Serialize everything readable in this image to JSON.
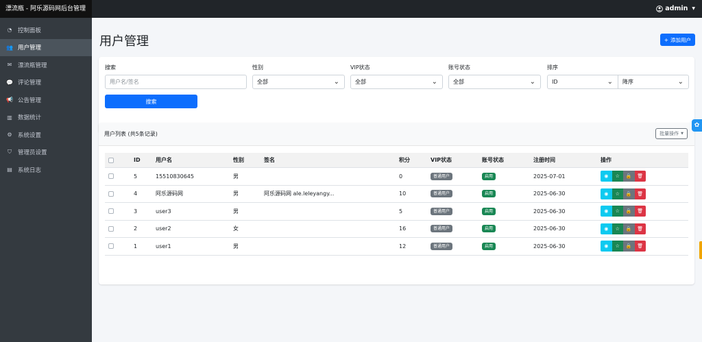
{
  "app": {
    "title": "漂流瓶 - 阿乐源码网后台管理",
    "user": "admin"
  },
  "sidebar": {
    "items": [
      {
        "label": "控制面板",
        "icon": "dashboard-icon",
        "glyph": "◔",
        "active": false
      },
      {
        "label": "用户管理",
        "icon": "users-icon",
        "glyph": "👥",
        "active": true
      },
      {
        "label": "漂流瓶管理",
        "icon": "envelope-icon",
        "glyph": "✉",
        "active": false
      },
      {
        "label": "评论管理",
        "icon": "comment-icon",
        "glyph": "💬",
        "active": false
      },
      {
        "label": "公告管理",
        "icon": "megaphone-icon",
        "glyph": "📢",
        "active": false
      },
      {
        "label": "数据统计",
        "icon": "bar-chart-icon",
        "glyph": "▥",
        "active": false
      },
      {
        "label": "系统设置",
        "icon": "gear-icon",
        "glyph": "⚙",
        "active": false
      },
      {
        "label": "管理员设置",
        "icon": "shield-icon",
        "glyph": "⛉",
        "active": false
      },
      {
        "label": "系统日志",
        "icon": "log-icon",
        "glyph": "▤",
        "active": false
      }
    ]
  },
  "page": {
    "title": "用户管理",
    "add_button": "添加用户"
  },
  "filters": {
    "search": {
      "label": "搜索",
      "placeholder": "用户名/签名"
    },
    "gender": {
      "label": "性别",
      "value": "全部"
    },
    "vip": {
      "label": "VIP状态",
      "value": "全部"
    },
    "account": {
      "label": "账号状态",
      "value": "全部"
    },
    "sort": {
      "label": "排序",
      "field": "ID",
      "order": "降序"
    },
    "search_button": "搜索"
  },
  "list": {
    "title": "用户列表 (共5条记录)",
    "batch_button": "批量操作",
    "columns": [
      "ID",
      "用户名",
      "性别",
      "签名",
      "积分",
      "VIP状态",
      "账号状态",
      "注册时间",
      "操作"
    ],
    "rows": [
      {
        "id": "5",
        "username": "15510830645",
        "gender": "男",
        "signature": "",
        "points": "0",
        "vip": "普通用户",
        "status": "启用",
        "registered": "2025-07-01"
      },
      {
        "id": "4",
        "username": "阿乐源码网",
        "gender": "男",
        "signature": "阿乐源码网 ale.leleyangy...",
        "points": "10",
        "vip": "普通用户",
        "status": "启用",
        "registered": "2025-06-30"
      },
      {
        "id": "3",
        "username": "user3",
        "gender": "男",
        "signature": "",
        "points": "5",
        "vip": "普通用户",
        "status": "启用",
        "registered": "2025-06-30"
      },
      {
        "id": "2",
        "username": "user2",
        "gender": "女",
        "signature": "",
        "points": "16",
        "vip": "普通用户",
        "status": "启用",
        "registered": "2025-06-30"
      },
      {
        "id": "1",
        "username": "user1",
        "gender": "男",
        "signature": "",
        "points": "12",
        "vip": "普通用户",
        "status": "启用",
        "registered": "2025-06-30"
      }
    ],
    "action_icons": [
      "eye-icon",
      "star-icon",
      "lock-icon",
      "trash-icon"
    ]
  },
  "colors": {
    "primary": "#0d6efd",
    "sidebar": "#343a40",
    "topbar": "#212529",
    "info": "#0dcaf0",
    "success": "#198754",
    "secondary": "#6c757d",
    "danger": "#dc3545"
  }
}
